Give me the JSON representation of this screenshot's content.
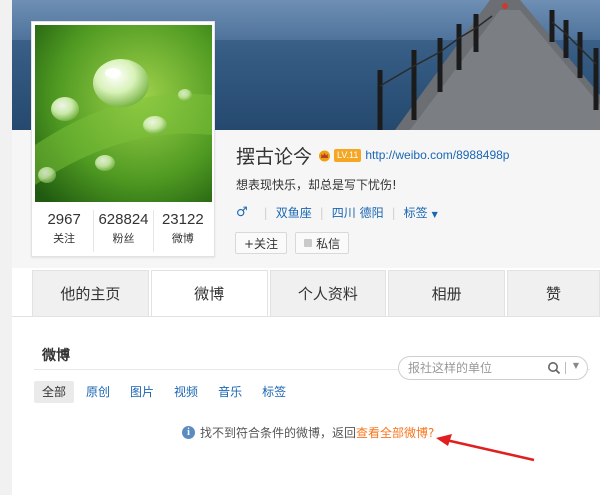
{
  "profile": {
    "name": "摆古论今",
    "level_badge": "LV.11",
    "url": "http://weibo.com/8988498p",
    "bio": "想表现快乐，却总是写下忧伤!",
    "gender_icon": "male-icon",
    "tags": [
      "双鱼座",
      "四川 德阳"
    ],
    "tag_menu_label": "标签",
    "follow_button": "+关注",
    "message_button": "私信",
    "stats": [
      {
        "value": "2967",
        "label": "关注"
      },
      {
        "value": "628824",
        "label": "粉丝"
      },
      {
        "value": "23122",
        "label": "微博"
      }
    ]
  },
  "tabs": [
    {
      "label": "他的主页",
      "active": false
    },
    {
      "label": "微博",
      "active": true
    },
    {
      "label": "个人资料",
      "active": false
    },
    {
      "label": "相册",
      "active": false
    },
    {
      "label": "赞",
      "active": false
    }
  ],
  "feed": {
    "title": "微博",
    "search_placeholder": "报社这样的单位",
    "filters": [
      {
        "label": "全部",
        "active": true
      },
      {
        "label": "原创",
        "active": false
      },
      {
        "label": "图片",
        "active": false
      },
      {
        "label": "视频",
        "active": false
      },
      {
        "label": "音乐",
        "active": false
      },
      {
        "label": "标签",
        "active": false
      }
    ],
    "notice_text": "找不到符合条件的微博，返回",
    "notice_link": "查看全部微博?"
  },
  "colors": {
    "link": "#1a66b3",
    "accent_orange": "#f7771e",
    "annotation_arrow": "#e02020"
  }
}
